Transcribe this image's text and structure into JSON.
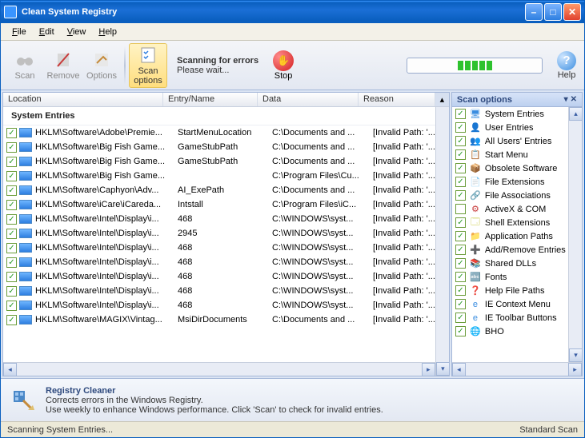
{
  "title": "Clean System Registry",
  "menu": {
    "file": "File",
    "edit": "Edit",
    "view": "View",
    "help": "Help"
  },
  "toolbar": {
    "scan": "Scan",
    "remove": "Remove",
    "options": "Options",
    "scanopts": "Scan options",
    "scanning": "Scanning for errors",
    "wait": "Please wait...",
    "stop": "Stop",
    "help": "Help"
  },
  "columns": {
    "location": "Location",
    "entry": "Entry/Name",
    "data": "Data",
    "reason": "Reason"
  },
  "group": "System Entries",
  "rows": [
    {
      "loc": "HKLM\\Software\\Adobe\\Premie...",
      "ent": "StartMenuLocation",
      "dat": "C:\\Documents and ...",
      "rea": "[Invalid Path: '..."
    },
    {
      "loc": "HKLM\\Software\\Big Fish Game...",
      "ent": "GameStubPath",
      "dat": "C:\\Documents and ...",
      "rea": "[Invalid Path: '..."
    },
    {
      "loc": "HKLM\\Software\\Big Fish Game...",
      "ent": "GameStubPath",
      "dat": "C:\\Documents and ...",
      "rea": "[Invalid Path: '..."
    },
    {
      "loc": "HKLM\\Software\\Big Fish Game...",
      "ent": "",
      "dat": "C:\\Program Files\\Cu...",
      "rea": "[Invalid Path: '..."
    },
    {
      "loc": "HKLM\\Software\\Caphyon\\Adv...",
      "ent": "AI_ExePath",
      "dat": "C:\\Documents and ...",
      "rea": "[Invalid Path: '..."
    },
    {
      "loc": "HKLM\\Software\\iCare\\iCareda...",
      "ent": "Intstall",
      "dat": "C:\\Program Files\\iC...",
      "rea": "[Invalid Path: '..."
    },
    {
      "loc": "HKLM\\Software\\Intel\\Display\\i...",
      "ent": "468",
      "dat": "C:\\WINDOWS\\syst...",
      "rea": "[Invalid Path: '..."
    },
    {
      "loc": "HKLM\\Software\\Intel\\Display\\i...",
      "ent": "2945",
      "dat": "C:\\WINDOWS\\syst...",
      "rea": "[Invalid Path: '..."
    },
    {
      "loc": "HKLM\\Software\\Intel\\Display\\i...",
      "ent": "468",
      "dat": "C:\\WINDOWS\\syst...",
      "rea": "[Invalid Path: '..."
    },
    {
      "loc": "HKLM\\Software\\Intel\\Display\\i...",
      "ent": "468",
      "dat": "C:\\WINDOWS\\syst...",
      "rea": "[Invalid Path: '..."
    },
    {
      "loc": "HKLM\\Software\\Intel\\Display\\i...",
      "ent": "468",
      "dat": "C:\\WINDOWS\\syst...",
      "rea": "[Invalid Path: '..."
    },
    {
      "loc": "HKLM\\Software\\Intel\\Display\\i...",
      "ent": "468",
      "dat": "C:\\WINDOWS\\syst...",
      "rea": "[Invalid Path: '..."
    },
    {
      "loc": "HKLM\\Software\\Intel\\Display\\i...",
      "ent": "468",
      "dat": "C:\\WINDOWS\\syst...",
      "rea": "[Invalid Path: '..."
    },
    {
      "loc": "HKLM\\Software\\MAGIX\\Vintag...",
      "ent": "MsiDirDocuments",
      "dat": "C:\\Documents and ...",
      "rea": "[Invalid Path: '..."
    }
  ],
  "sidepanel": {
    "title": "Scan options"
  },
  "opts": [
    {
      "label": "System Entries",
      "checked": true,
      "color": "#3a8de0",
      "glyph": "🖥"
    },
    {
      "label": "User Entries",
      "checked": true,
      "color": "#6a4a9e",
      "glyph": "👤"
    },
    {
      "label": "All Users' Entries",
      "checked": true,
      "color": "#6a4a9e",
      "glyph": "👥"
    },
    {
      "label": "Start Menu",
      "checked": true,
      "color": "#3a8de0",
      "glyph": "📋"
    },
    {
      "label": "Obsolete Software",
      "checked": true,
      "color": "#c58a3a",
      "glyph": "📦"
    },
    {
      "label": "File Extensions",
      "checked": true,
      "color": "#d8d8a0",
      "glyph": "📄"
    },
    {
      "label": "File Associations",
      "checked": true,
      "color": "#6a6a6a",
      "glyph": "🔗"
    },
    {
      "label": "ActiveX & COM",
      "checked": false,
      "color": "#c83a3a",
      "glyph": "⚙"
    },
    {
      "label": "Shell Extensions",
      "checked": true,
      "color": "#c8c83a",
      "glyph": "🗔"
    },
    {
      "label": "Application Paths",
      "checked": true,
      "color": "#c58a3a",
      "glyph": "📁"
    },
    {
      "label": "Add/Remove Entries",
      "checked": true,
      "color": "#3a8de0",
      "glyph": "➕"
    },
    {
      "label": "Shared DLLs",
      "checked": true,
      "color": "#c58a3a",
      "glyph": "📚"
    },
    {
      "label": "Fonts",
      "checked": true,
      "color": "#3a8de0",
      "glyph": "🔤"
    },
    {
      "label": "Help File Paths",
      "checked": true,
      "color": "#7a3ab8",
      "glyph": "❓"
    },
    {
      "label": "IE Context Menu",
      "checked": true,
      "color": "#3a8de0",
      "glyph": "e"
    },
    {
      "label": "IE Toolbar Buttons",
      "checked": true,
      "color": "#3a8de0",
      "glyph": "e"
    },
    {
      "label": "BHO",
      "checked": true,
      "color": "#3a8de0",
      "glyph": "🌐"
    }
  ],
  "info": {
    "title": "Registry Cleaner",
    "line1": "Corrects errors in the Windows Registry.",
    "line2": "Use weekly to enhance Windows performance. Click 'Scan' to check for invalid entries."
  },
  "status": {
    "left": "Scanning System Entries...",
    "right": "Standard Scan"
  }
}
